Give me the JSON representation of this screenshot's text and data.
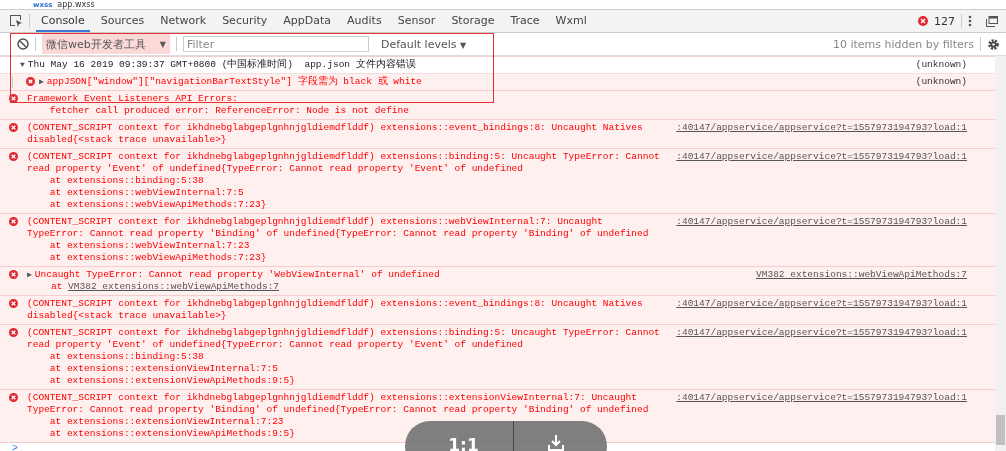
{
  "file_tab": {
    "label": "app.wxss",
    "icon": "wxss"
  },
  "tabs": [
    {
      "label": "Console",
      "selected": true
    },
    {
      "label": "Sources",
      "selected": false
    },
    {
      "label": "Network",
      "selected": false
    },
    {
      "label": "Security",
      "selected": false
    },
    {
      "label": "AppData",
      "selected": false
    },
    {
      "label": "Audits",
      "selected": false
    },
    {
      "label": "Sensor",
      "selected": false
    },
    {
      "label": "Storage",
      "selected": false
    },
    {
      "label": "Trace",
      "selected": false
    },
    {
      "label": "Wxml",
      "selected": false
    }
  ],
  "error_count": "127",
  "toolbar": {
    "context": "微信web开发者工具",
    "context_caret": "▼",
    "filter_placeholder": "Filter",
    "levels": "Default levels",
    "levels_caret": "▼",
    "hidden": "10 items hidden by filters"
  },
  "messages": [
    {
      "kind": "group",
      "toggle": "▼",
      "message": "Thu May 16 2019 09:39:37 GMT+0800 (中国标准时间)  app.json 文件内容错误",
      "source": "(unknown)"
    },
    {
      "kind": "nested-error",
      "toggle": "▶",
      "message": "appJSON[\"window\"][\"navigationBarTextStyle\"] 字段需为 black 或 white",
      "source": "(unknown)"
    },
    {
      "kind": "error",
      "message": "Framework Event Listeners API Errors:\n    fetcher call produced error: ReferenceError: Node is not define"
    },
    {
      "kind": "error",
      "message": "(CONTENT_SCRIPT context for ikhdnebglabgeplgnhnjgldiemdflddf) extensions::event_bindings:8: Uncaught Natives\ndisabled{<stack trace unavailable>}",
      "source": ":40147/appservice/appservice?t=1557973194793?load:1"
    },
    {
      "kind": "error",
      "message": "(CONTENT_SCRIPT context for ikhdnebglabgeplgnhnjgldiemdflddf) extensions::binding:5: Uncaught TypeError: Cannot\nread property 'Event' of undefined{TypeError: Cannot read property 'Event' of undefined\n    at extensions::binding:5:38\n    at extensions::webViewInternal:7:5\n    at extensions::webViewApiMethods:7:23}",
      "source": ":40147/appservice/appservice?t=1557973194793?load:1"
    },
    {
      "kind": "error",
      "message": "(CONTENT_SCRIPT context for ikhdnebglabgeplgnhnjgldiemdflddf) extensions::webViewInternal:7: Uncaught\nTypeError: Cannot read property 'Binding' of undefined{TypeError: Cannot read property 'Binding' of undefined\n    at extensions::webViewInternal:7:23\n    at extensions::webViewApiMethods:7:23}",
      "source": ":40147/appservice/appservice?t=1557973194793?load:1"
    },
    {
      "kind": "error",
      "toggle": "▶",
      "message": "Uncaught TypeError: Cannot read property 'WebViewInternal' of undefined",
      "stack_prefix": "at",
      "stack_link": "VM382 extensions::webViewApiMethods:7",
      "source": "VM382 extensions::webViewApiMethods:7"
    },
    {
      "kind": "error",
      "message": "(CONTENT_SCRIPT context for ikhdnebglabgeplgnhnjgldiemdflddf) extensions::event_bindings:8: Uncaught Natives\ndisabled{<stack trace unavailable>}",
      "source": ":40147/appservice/appservice?t=1557973194793?load:1"
    },
    {
      "kind": "error",
      "message": "(CONTENT_SCRIPT context for ikhdnebglabgeplgnhnjgldiemdflddf) extensions::binding:5: Uncaught TypeError: Cannot\nread property 'Event' of undefined{TypeError: Cannot read property 'Event' of undefined\n    at extensions::binding:5:38\n    at extensions::extensionViewInternal:7:5\n    at extensions::extensionViewApiMethods:9:5}",
      "source": ":40147/appservice/appservice?t=1557973194793?load:1"
    },
    {
      "kind": "error",
      "message": "(CONTENT_SCRIPT context for ikhdnebglabgeplgnhnjgldiemdflddf) extensions::extensionViewInternal:7: Uncaught\nTypeError: Cannot read property 'Binding' of undefined{TypeError: Cannot read property 'Binding' of undefined\n    at extensions::extensionViewInternal:7:23\n    at extensions::extensionViewApiMethods:9:5}",
      "source": ":40147/appservice/appservice?t=1557973194793?load:1"
    }
  ],
  "prompt": ">",
  "viewer": {
    "zoom_label": "1:1"
  }
}
